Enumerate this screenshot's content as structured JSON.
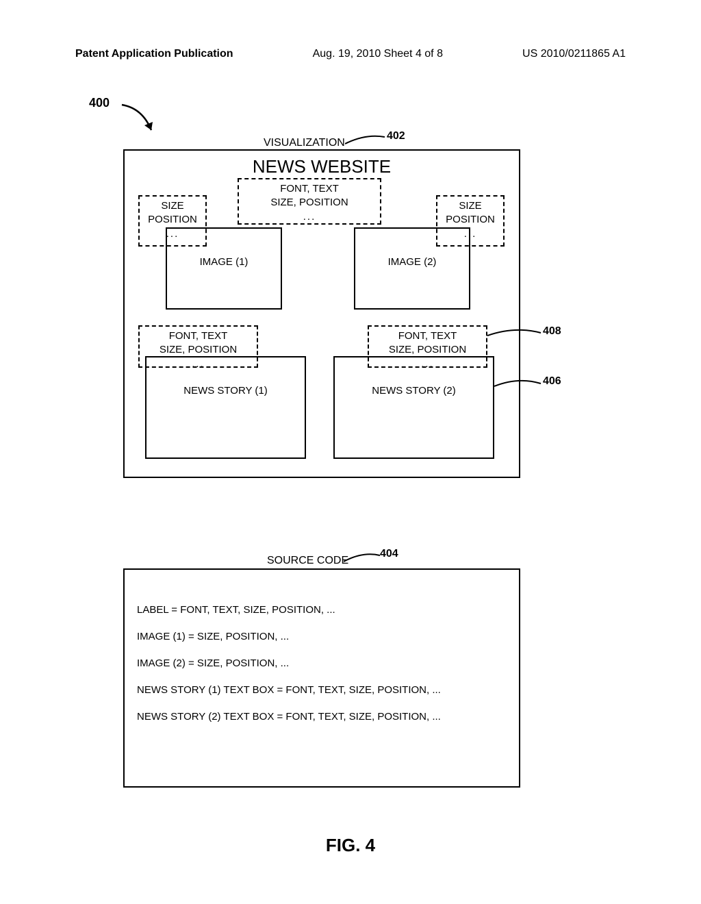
{
  "header": {
    "left": "Patent Application Publication",
    "mid": "Aug. 19, 2010   Sheet 4 of 8",
    "right": "US 2010/0211865 A1"
  },
  "fig_caption": "FIG. 4",
  "labels": {
    "n400": "400",
    "n402": "402",
    "n404": "404",
    "n406": "406",
    "n408": "408"
  },
  "panel_titles": {
    "visualization": "VISUALIZATION",
    "source_code": "SOURCE CODE"
  },
  "visbox": {
    "title": "NEWS WEBSITE",
    "title_anno": "FONT, TEXT\nSIZE, POSITION\n...",
    "img_anno": "SIZE\nPOSITION\n...",
    "story_anno": "FONT, TEXT\nSIZE, POSITION\n...",
    "image1": "IMAGE (1)",
    "image2": "IMAGE (2)",
    "story1": "NEWS STORY (1)",
    "story2": "NEWS STORY (2)"
  },
  "source_lines": {
    "l1": "LABEL = FONT, TEXT, SIZE, POSITION, ...",
    "l2": "IMAGE (1) = SIZE, POSITION, ...",
    "l3": "IMAGE (2) = SIZE, POSITION, ...",
    "l4": "NEWS STORY (1) TEXT BOX = FONT, TEXT, SIZE, POSITION, ...",
    "l5": "NEWS STORY (2) TEXT BOX = FONT, TEXT, SIZE, POSITION, ..."
  }
}
